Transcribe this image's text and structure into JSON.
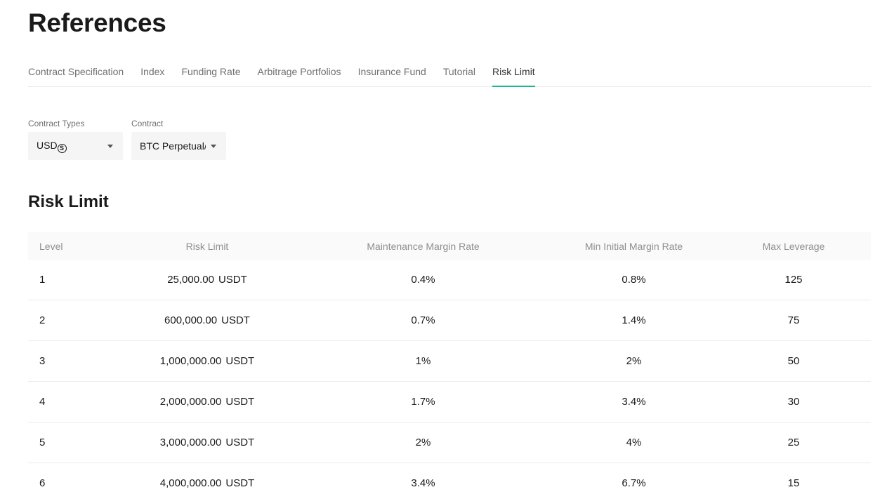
{
  "page": {
    "title": "References"
  },
  "tabs": [
    {
      "label": "Contract Specification"
    },
    {
      "label": "Index"
    },
    {
      "label": "Funding Rate"
    },
    {
      "label": "Arbitrage Portfolios"
    },
    {
      "label": "Insurance Fund"
    },
    {
      "label": "Tutorial"
    },
    {
      "label": "Risk Limit",
      "active": true
    }
  ],
  "filters": {
    "contract_types": {
      "label": "Contract Types",
      "value": "USD",
      "icon": "usdt-coin-icon"
    },
    "contract": {
      "label": "Contract",
      "value": "BTC Perpetual/"
    }
  },
  "risk_limit": {
    "title": "Risk Limit",
    "columns": {
      "level": "Level",
      "risk_limit": "Risk Limit",
      "maintenance_margin_rate": "Maintenance Margin Rate",
      "min_initial_margin_rate": "Min Initial Margin Rate",
      "max_leverage": "Max Leverage"
    },
    "rows": [
      {
        "level": "1",
        "risk_limit": "25,000.00",
        "unit": "USDT",
        "mmr": "0.4%",
        "imr": "0.8%",
        "leverage": "125"
      },
      {
        "level": "2",
        "risk_limit": "600,000.00",
        "unit": "USDT",
        "mmr": "0.7%",
        "imr": "1.4%",
        "leverage": "75"
      },
      {
        "level": "3",
        "risk_limit": "1,000,000.00",
        "unit": "USDT",
        "mmr": "1%",
        "imr": "2%",
        "leverage": "50"
      },
      {
        "level": "4",
        "risk_limit": "2,000,000.00",
        "unit": "USDT",
        "mmr": "1.7%",
        "imr": "3.4%",
        "leverage": "30"
      },
      {
        "level": "5",
        "risk_limit": "3,000,000.00",
        "unit": "USDT",
        "mmr": "2%",
        "imr": "4%",
        "leverage": "25"
      },
      {
        "level": "6",
        "risk_limit": "4,000,000.00",
        "unit": "USDT",
        "mmr": "3.4%",
        "imr": "6.7%",
        "leverage": "15"
      }
    ]
  },
  "colors": {
    "accent": "#1fb58e",
    "header_bg": "#fafafa",
    "select_bg": "#f5f5f5"
  }
}
